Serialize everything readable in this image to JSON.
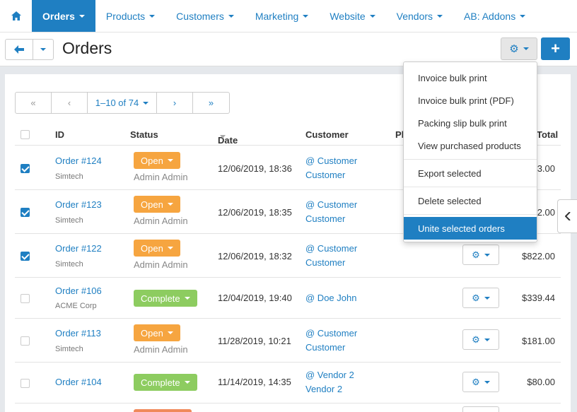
{
  "nav": {
    "home_icon": "home-icon",
    "items": [
      {
        "label": "Orders",
        "active": true
      },
      {
        "label": "Products"
      },
      {
        "label": "Customers"
      },
      {
        "label": "Marketing"
      },
      {
        "label": "Website"
      },
      {
        "label": "Vendors"
      },
      {
        "label": "AB: Addons"
      }
    ]
  },
  "header": {
    "back_icon": "arrow-left-icon",
    "title": "Orders",
    "gear_icon": "gear-icon",
    "add_label": "+"
  },
  "pager": {
    "first": "«",
    "prev": "‹",
    "range": "1–10 of 74",
    "next": "›",
    "last": "»"
  },
  "table": {
    "columns": {
      "id": "ID",
      "status": "Status",
      "date": "Date",
      "customer": "Customer",
      "phone": "Pl",
      "total": "Total"
    },
    "rows": [
      {
        "id": "Order #124",
        "company": "Simtech",
        "status": "Open",
        "status_type": "open",
        "admin": "Admin Admin",
        "date": "12/06/2019, 18:36",
        "customer1": "@ Customer",
        "customer2": "Customer",
        "total": "3.00",
        "checked": true
      },
      {
        "id": "Order #123",
        "company": "Simtech",
        "status": "Open",
        "status_type": "open",
        "admin": "Admin Admin",
        "date": "12/06/2019, 18:35",
        "customer1": "@ Customer",
        "customer2": "Customer",
        "total": "2.00",
        "checked": true
      },
      {
        "id": "Order #122",
        "company": "Simtech",
        "status": "Open",
        "status_type": "open",
        "admin": "Admin Admin",
        "date": "12/06/2019, 18:32",
        "customer1": "@ Customer",
        "customer2": "Customer",
        "total": "$822.00",
        "checked": true
      },
      {
        "id": "Order #106",
        "company": "ACME Corp",
        "status": "Complete",
        "status_type": "complete",
        "admin": "",
        "date": "12/04/2019, 19:40",
        "customer1": "@ Doe John",
        "customer2": "",
        "total": "$339.44",
        "checked": false
      },
      {
        "id": "Order #113",
        "company": "Simtech",
        "status": "Open",
        "status_type": "open",
        "admin": "Admin Admin",
        "date": "11/28/2019, 10:21",
        "customer1": "@ Customer",
        "customer2": "Customer",
        "total": "$181.00",
        "checked": false
      },
      {
        "id": "Order #104",
        "company": "",
        "status": "Complete",
        "status_type": "complete",
        "admin": "",
        "date": "11/14/2019, 14:35",
        "customer1": "@ Vendor 2",
        "customer2": "Vendor 2",
        "total": "$80.00",
        "checked": false
      }
    ]
  },
  "dropdown": {
    "items": [
      "Invoice bulk print",
      "Invoice bulk print (PDF)",
      "Packing slip bulk print",
      "View purchased products",
      "Export selected",
      "Delete selected",
      "Unite selected orders"
    ]
  },
  "colors": {
    "primary": "#1f7fc2",
    "open": "#f6a540",
    "complete": "#8dcc60"
  }
}
